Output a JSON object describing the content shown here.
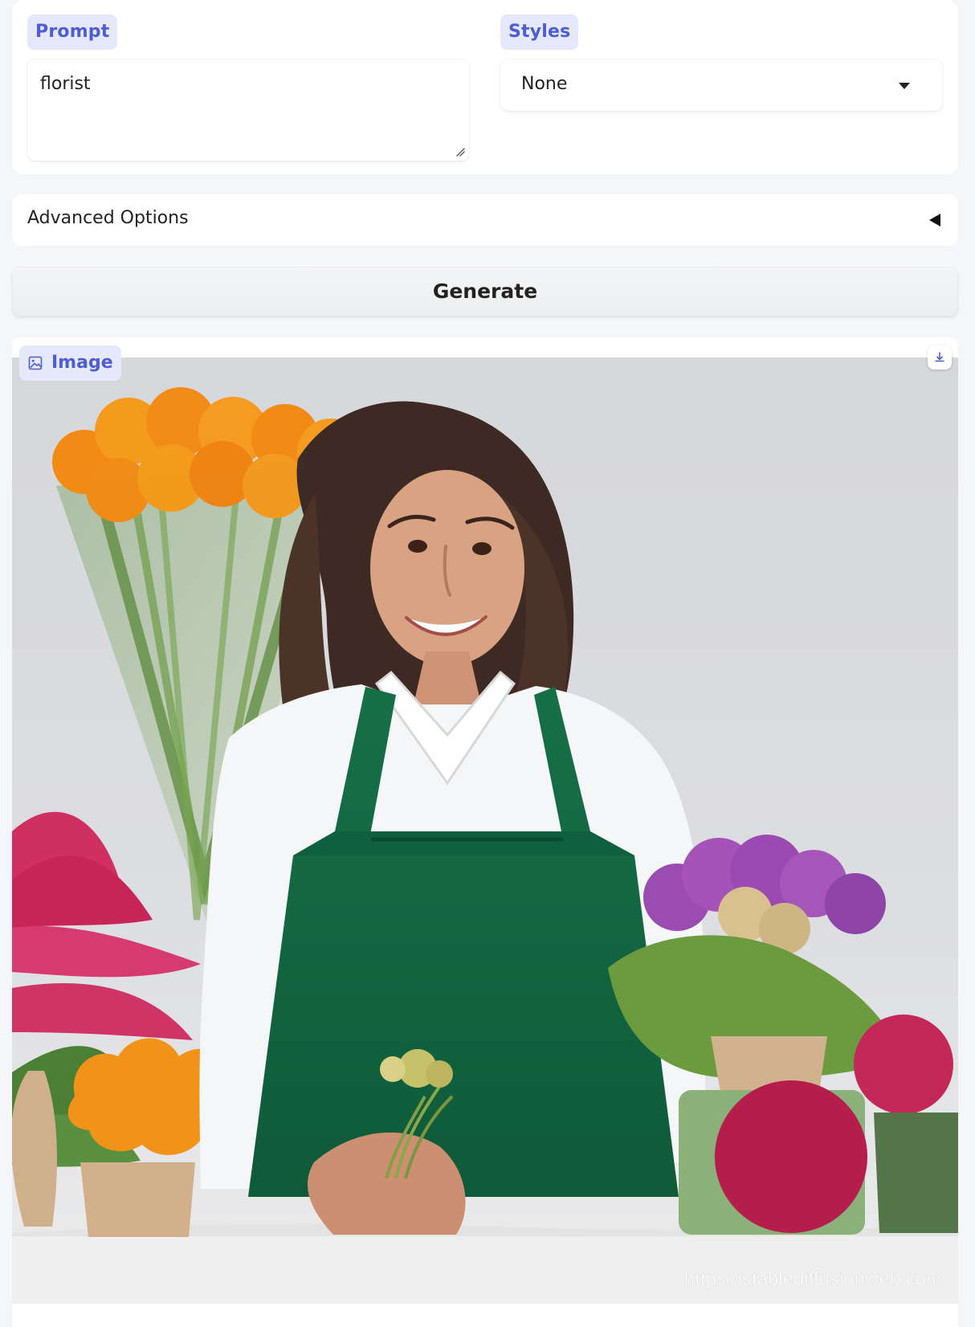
{
  "form": {
    "prompt": {
      "label": "Prompt",
      "value": "florist"
    },
    "styles": {
      "label": "Styles",
      "value": "None"
    }
  },
  "advanced": {
    "label": "Advanced Options"
  },
  "actions": {
    "generate_label": "Generate"
  },
  "output": {
    "label": "Image",
    "watermark": "https://stablediffusionweb.com"
  },
  "icons": {
    "prompt_resize": "resize-handle-icon",
    "select_caret": "chevron-down-icon",
    "advanced_toggle": "triangle-left-icon",
    "image_label": "image-icon",
    "download": "download-icon"
  },
  "colors": {
    "label_chip_bg": "#e6e9fb",
    "label_chip_text": "#4e5dd3",
    "page_bg": "#f5f6f8",
    "panel_bg": "#ffffff"
  }
}
